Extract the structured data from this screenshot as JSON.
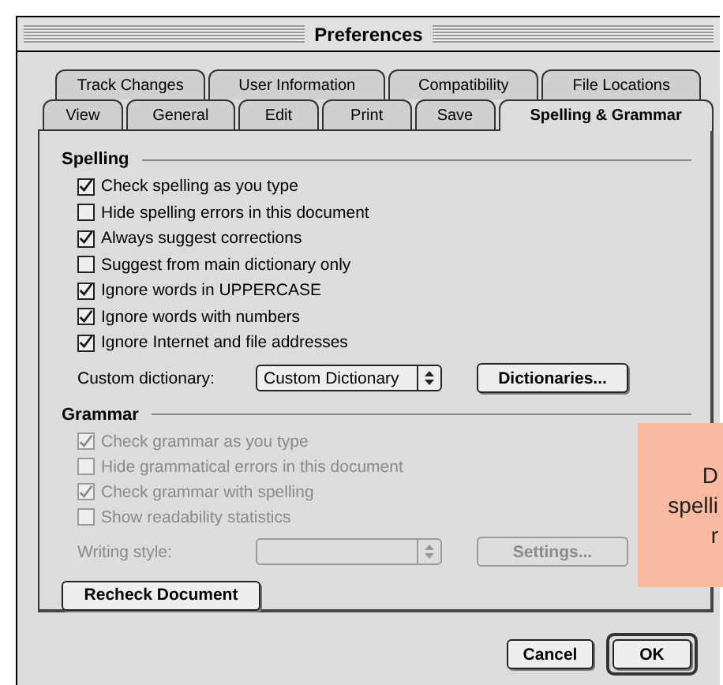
{
  "window": {
    "title": "Preferences"
  },
  "tab_rows": [
    {
      "tabs": [
        {
          "label": "Track Changes",
          "selected": false
        },
        {
          "label": "User Information",
          "selected": false
        },
        {
          "label": "Compatibility",
          "selected": false
        },
        {
          "label": "File Locations",
          "selected": false
        }
      ]
    },
    {
      "tabs": [
        {
          "label": "View",
          "selected": false
        },
        {
          "label": "General",
          "selected": false
        },
        {
          "label": "Edit",
          "selected": false
        },
        {
          "label": "Print",
          "selected": false
        },
        {
          "label": "Save",
          "selected": false
        },
        {
          "label": "Spelling & Grammar",
          "selected": true
        }
      ]
    }
  ],
  "spelling": {
    "heading": "Spelling",
    "disabled": false,
    "options": [
      {
        "label": "Check spelling as you type",
        "checked": true
      },
      {
        "label": "Hide spelling errors in this document",
        "checked": false
      },
      {
        "label": "Always suggest corrections",
        "checked": true
      },
      {
        "label": "Suggest from main dictionary only",
        "checked": false
      },
      {
        "label": "Ignore words in UPPERCASE",
        "checked": true
      },
      {
        "label": "Ignore words with numbers",
        "checked": true
      },
      {
        "label": "Ignore Internet and file addresses",
        "checked": true
      }
    ],
    "select": {
      "label": "Custom dictionary:",
      "value": "Custom Dictionary"
    },
    "button": "Dictionaries..."
  },
  "grammar": {
    "heading": "Grammar",
    "disabled": true,
    "options": [
      {
        "label": "Check grammar as you type",
        "checked": true
      },
      {
        "label": "Hide grammatical errors in this document",
        "checked": false
      },
      {
        "label": "Check grammar with spelling",
        "checked": true
      },
      {
        "label": "Show readability statistics",
        "checked": false
      }
    ],
    "select": {
      "label": "Writing style:"
    },
    "button": "Settings..."
  },
  "recheck_button": "Recheck Document",
  "buttons": [
    {
      "label": "Cancel",
      "default": false
    },
    {
      "label": "OK",
      "default": true
    }
  ],
  "callout": {
    "lines": [
      "D",
      "spelli",
      "r"
    ]
  }
}
